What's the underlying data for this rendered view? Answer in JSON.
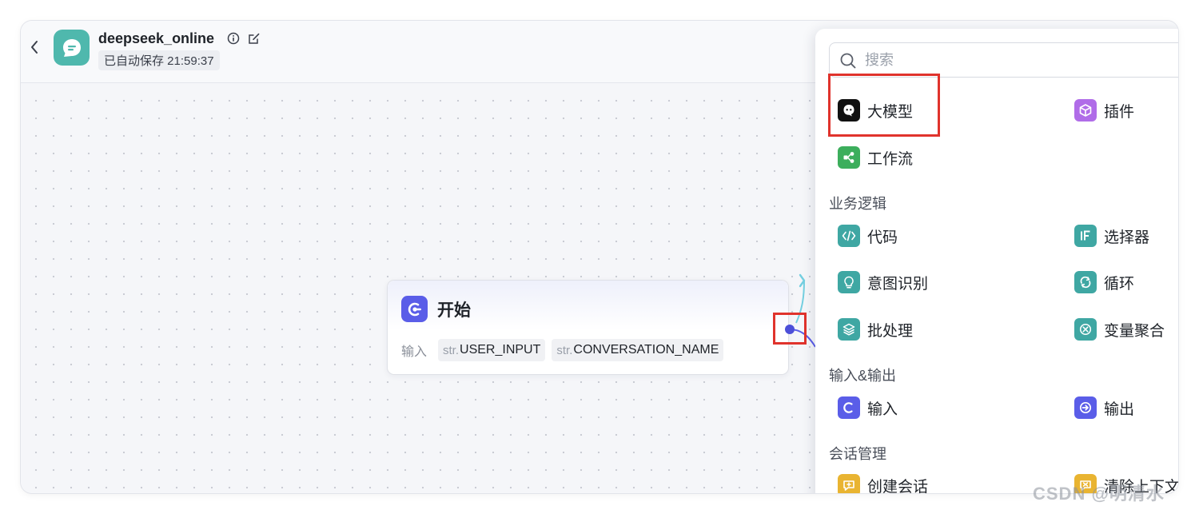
{
  "header": {
    "app_name": "deepseek_online",
    "save_status": "已自动保存 21:59:37"
  },
  "start_node": {
    "title": "开始",
    "inputs_label": "输入",
    "inputs": [
      {
        "type": "str.",
        "name": "USER_INPUT"
      },
      {
        "type": "str.",
        "name": "CONVERSATION_NAME"
      }
    ]
  },
  "panel": {
    "search_placeholder": "搜索",
    "top_items": [
      {
        "label": "大模型",
        "icon": "llm-icon",
        "color": "#111111"
      },
      {
        "label": "插件",
        "icon": "plugin-cube-icon",
        "color": "#b06ce8"
      },
      {
        "label": "工作流",
        "icon": "workflow-icon",
        "color": "#3cae5c"
      }
    ],
    "sections": [
      {
        "title": "业务逻辑",
        "items": [
          {
            "label": "代码",
            "icon": "code-icon",
            "color": "#3fa7a3"
          },
          {
            "label": "选择器",
            "icon": "if-selector-icon",
            "color": "#3fa7a3"
          },
          {
            "label": "意图识别",
            "icon": "intent-bulb-icon",
            "color": "#3fa7a3"
          },
          {
            "label": "循环",
            "icon": "loop-icon",
            "color": "#3fa7a3"
          },
          {
            "label": "批处理",
            "icon": "batch-layers-icon",
            "color": "#3fa7a3"
          },
          {
            "label": "变量聚合",
            "icon": "variable-merge-icon",
            "color": "#3fa7a3"
          }
        ]
      },
      {
        "title": "输入&输出",
        "items": [
          {
            "label": "输入",
            "icon": "input-icon",
            "color": "#5a5de8"
          },
          {
            "label": "输出",
            "icon": "output-icon",
            "color": "#5a5de8"
          }
        ]
      },
      {
        "title": "会话管理",
        "items": [
          {
            "label": "创建会话",
            "icon": "create-conversation-icon",
            "color": "#e9b431"
          },
          {
            "label": "清除上下文",
            "icon": "clear-context-icon",
            "color": "#e9b431"
          }
        ]
      }
    ]
  },
  "watermark": "CSDN @明清水"
}
